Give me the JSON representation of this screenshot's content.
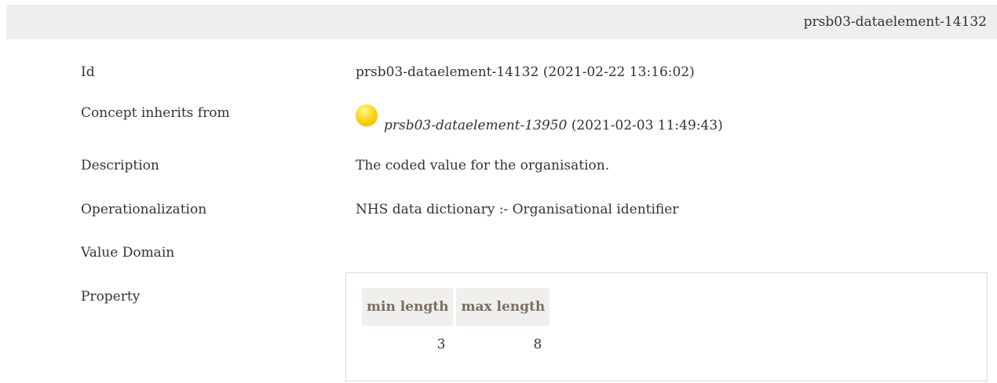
{
  "header": {
    "element_id": "prsb03-dataelement-14132"
  },
  "rows": {
    "id": {
      "label": "Id",
      "value": "prsb03-dataelement-14132 (2021-02-22 13:16:02)"
    },
    "inherits": {
      "label": "Concept inherits from",
      "icon": "yellow-ball-icon",
      "ref_id": "prsb03-dataelement-13950",
      "ref_date": "(2021-02-03 11:49:43)"
    },
    "description": {
      "label": "Description",
      "value": "The coded value for the organisation."
    },
    "operationalization": {
      "label": "Operationalization",
      "value": "NHS data dictionary :- Organisational identifier"
    },
    "value_domain": {
      "label": "Value Domain"
    },
    "property": {
      "label": "Property",
      "headers": [
        "min length",
        "max length"
      ],
      "values": [
        "3",
        "8"
      ]
    }
  }
}
